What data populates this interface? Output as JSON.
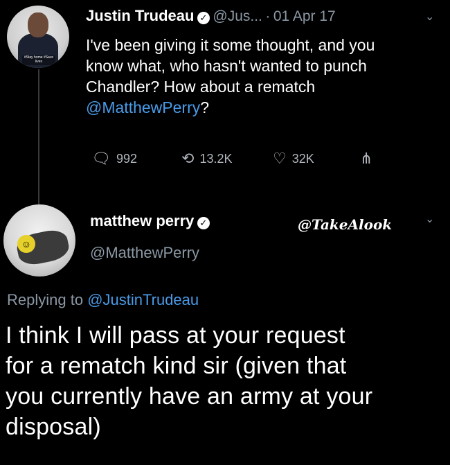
{
  "tweet1": {
    "avatar_tag": "#Stay home #Save lives",
    "display_name": "Justin Trudeau",
    "handle": "@Jus...",
    "separator": "·",
    "date": "01 Apr 17",
    "text_lines": [
      "I've been giving it some thought, and you",
      "know what, who hasn't wanted to punch",
      "Chandler? How about a rematch"
    ],
    "mention": "@MatthewPerry",
    "mention_suffix": "?",
    "replies": "992",
    "retweets": "13.2K",
    "likes": "32K"
  },
  "tweet2": {
    "display_name": "matthew perry",
    "handle": "@MatthewPerry",
    "watermark": "@TakeAlook",
    "replying_prefix": "Replying to",
    "replying_to": "@JustinTrudeau",
    "text_lines": [
      "I think I will pass at your request",
      "for a rematch kind sir (given that",
      "you currently have an army at your",
      "disposal)"
    ]
  },
  "icons": {
    "verified": "verified-badge-icon",
    "reply": "reply-icon",
    "retweet": "retweet-icon",
    "like": "heart-icon",
    "share": "share-icon",
    "more": "chevron-down-icon"
  },
  "colors": {
    "background": "#000000",
    "link": "#4a9be8",
    "muted": "#8b98a5"
  }
}
